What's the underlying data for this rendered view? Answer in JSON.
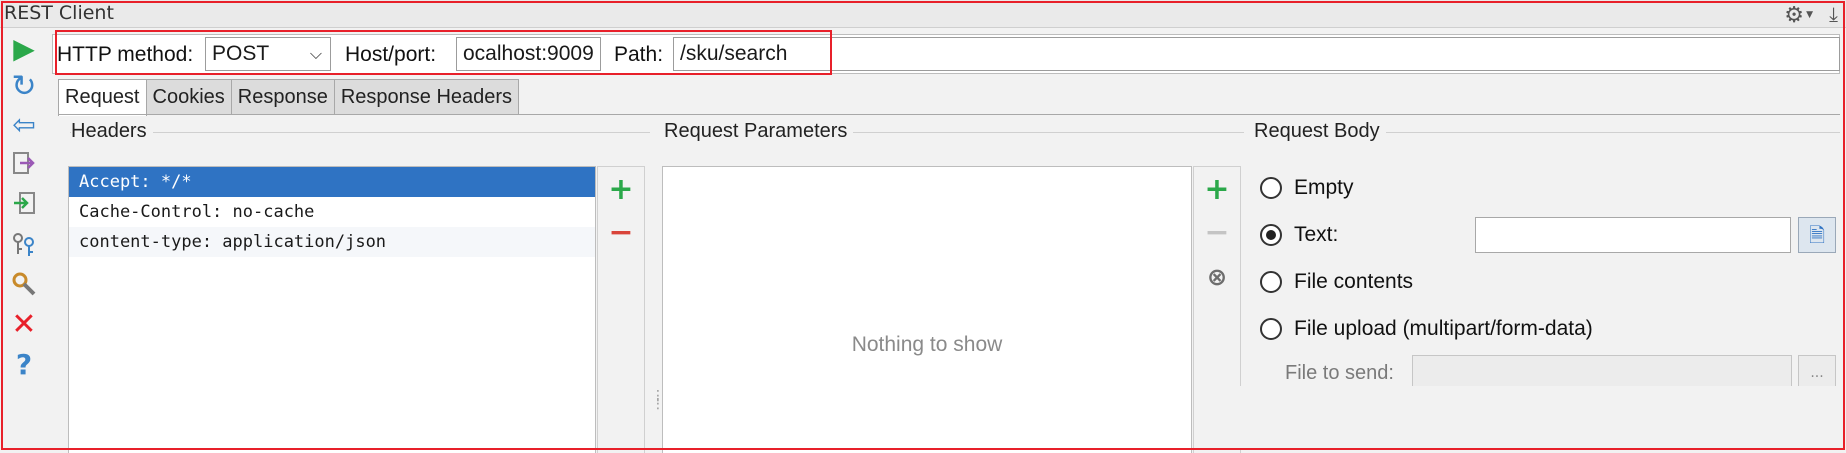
{
  "window": {
    "title": "REST Client"
  },
  "icons": {
    "run": "play-icon",
    "resubmit": "refresh-icon",
    "back": "back-arrow-icon",
    "export": "export-icon",
    "import": "import-icon",
    "keys": "keys-icon",
    "tools": "wrench-icon",
    "close": "close-icon",
    "help": "help-icon",
    "settings": "gear-icon",
    "download": "download-icon"
  },
  "request_line": {
    "method_label": "HTTP method:",
    "method_value": "POST",
    "host_label": "Host/port:",
    "host_value": "ocalhost:9009",
    "path_label": "Path:",
    "path_value": "/sku/search"
  },
  "tabs": [
    {
      "label": "Request",
      "active": true
    },
    {
      "label": "Cookies",
      "active": false
    },
    {
      "label": "Response",
      "active": false
    },
    {
      "label": "Response Headers",
      "active": false
    }
  ],
  "headers_panel": {
    "title": "Headers",
    "rows": [
      "Accept: */*",
      "Cache-Control: no-cache",
      "content-type: application/json"
    ],
    "add_label": "+",
    "remove_label": "−"
  },
  "params_panel": {
    "title": "Request Parameters",
    "empty_text": "Nothing to show",
    "add_label": "+",
    "remove_label": "−",
    "clear_label": "⊗"
  },
  "body_panel": {
    "title": "Request Body",
    "options": [
      "Empty",
      "Text:",
      "File contents",
      "File upload (multipart/form-data)"
    ],
    "selected": "Text:",
    "file_label": "File to send:",
    "browse_label": "..."
  },
  "colors": {
    "accent": "#2f73c3",
    "highlight_red": "#e8202a",
    "run_green": "#2ba84a"
  }
}
